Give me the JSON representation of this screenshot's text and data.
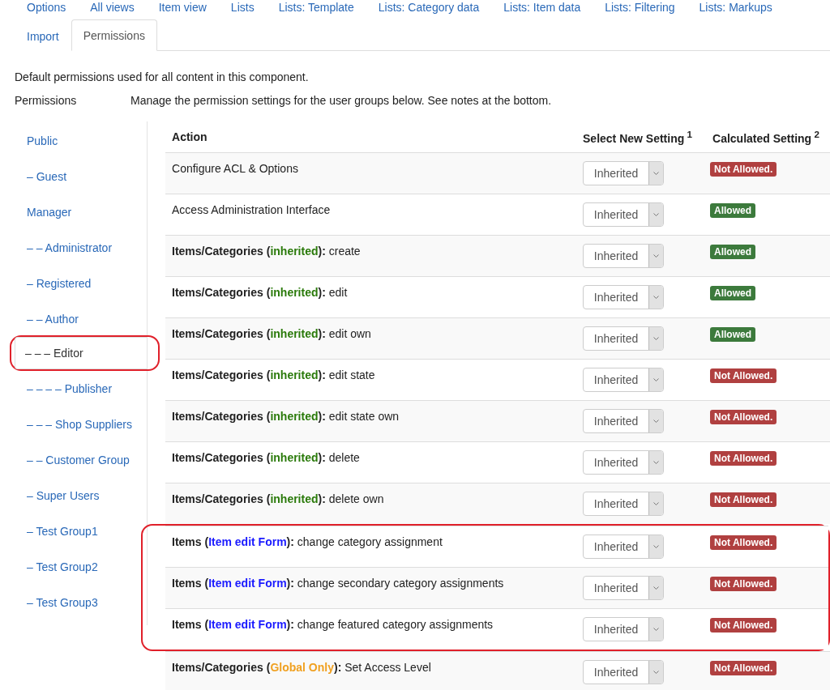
{
  "tabs_row_1": [
    {
      "label": "Options",
      "selected": false
    },
    {
      "label": "All views",
      "selected": false
    },
    {
      "label": "Item view",
      "selected": false
    },
    {
      "label": "Lists",
      "selected": false
    },
    {
      "label": "Lists: Template",
      "selected": false
    },
    {
      "label": "Lists: Category data",
      "selected": false
    },
    {
      "label": "Lists: Item data",
      "selected": false
    },
    {
      "label": "Lists: Filtering",
      "selected": false
    },
    {
      "label": "Lists: Markups",
      "selected": false
    }
  ],
  "tabs_row_2": [
    {
      "label": "Import",
      "selected": false
    },
    {
      "label": "Permissions",
      "selected": true
    }
  ],
  "intro": "Default permissions used for all content in this component.",
  "field_label": "Permissions",
  "field_description": "Manage the permission settings for the user groups below. See notes at the bottom.",
  "groups": [
    {
      "label": "Public",
      "selected": false,
      "circled": false
    },
    {
      "label": "– Guest",
      "selected": false,
      "circled": false
    },
    {
      "label": "Manager",
      "selected": false,
      "circled": false
    },
    {
      "label": "– – Administrator",
      "selected": false,
      "circled": false
    },
    {
      "label": "– Registered",
      "selected": false,
      "circled": false
    },
    {
      "label": "– – Author",
      "selected": false,
      "circled": false
    },
    {
      "label": "– – – Editor",
      "selected": true,
      "circled": true
    },
    {
      "label": "– – – – Publisher",
      "selected": false,
      "circled": false
    },
    {
      "label": "– – – Shop Suppliers",
      "selected": false,
      "circled": false
    },
    {
      "label": "– – Customer Group",
      "selected": false,
      "circled": false
    },
    {
      "label": "– Super Users",
      "selected": false,
      "circled": false
    },
    {
      "label": "– Test Group1",
      "selected": false,
      "circled": false
    },
    {
      "label": "– Test Group2",
      "selected": false,
      "circled": false
    },
    {
      "label": "– Test Group3",
      "selected": false,
      "circled": false
    }
  ],
  "table": {
    "columns": [
      {
        "label": "Action"
      },
      {
        "label": "Select New Setting",
        "note": "1"
      },
      {
        "label": "Calculated Setting",
        "note": "2"
      }
    ],
    "rows": [
      {
        "kind": "plain",
        "text": "Configure ACL & Options",
        "setting": "Inherited",
        "result": "Not Allowed.",
        "allowed": false,
        "circled": false
      },
      {
        "kind": "plain",
        "text": "Access Administration Interface",
        "setting": "Inherited",
        "result": "Allowed",
        "allowed": true,
        "circled": false
      },
      {
        "kind": "scoped",
        "prefix": "Items/Categories (",
        "scope": "inherited",
        "color": "#2a7a0a",
        "text": "**):** create",
        "setting": "Inherited",
        "result": "Allowed",
        "allowed": true,
        "circled": false
      },
      {
        "kind": "scoped",
        "prefix": "Items/Categories (",
        "scope": "inherited",
        "color": "#2a7a0a",
        "text": "**):** edit",
        "setting": "Inherited",
        "result": "Allowed",
        "allowed": true,
        "circled": false
      },
      {
        "kind": "scoped",
        "prefix": "Items/Categories (",
        "scope": "inherited",
        "color": "#2a7a0a",
        "text": "**):** edit own",
        "setting": "Inherited",
        "result": "Allowed",
        "allowed": true,
        "circled": false
      },
      {
        "kind": "scoped",
        "prefix": "Items/Categories (",
        "scope": "inherited",
        "color": "#2a7a0a",
        "text": "**):** edit state",
        "setting": "Inherited",
        "result": "Not Allowed.",
        "allowed": false,
        "circled": false
      },
      {
        "kind": "scoped",
        "prefix": "Items/Categories (",
        "scope": "inherited",
        "color": "#2a7a0a",
        "text": "**):** edit state own",
        "setting": "Inherited",
        "result": "Not Allowed.",
        "allowed": false,
        "circled": false
      },
      {
        "kind": "scoped",
        "prefix": "Items/Categories (",
        "scope": "inherited",
        "color": "#2a7a0a",
        "text": "**):** delete",
        "setting": "Inherited",
        "result": "Not Allowed.",
        "allowed": false,
        "circled": false
      },
      {
        "kind": "scoped",
        "prefix": "Items/Categories (",
        "scope": "inherited",
        "color": "#2a7a0a",
        "text": "**):** delete own",
        "setting": "Inherited",
        "result": "Not Allowed.",
        "allowed": false,
        "circled": false
      },
      {
        "kind": "scoped",
        "prefix": "Items (",
        "scope": "Item edit Form",
        "color": "#1a1aff",
        "text": "**):** change category assignment",
        "setting": "Inherited",
        "result": "Not Allowed.",
        "allowed": false,
        "circled": true
      },
      {
        "kind": "scoped",
        "prefix": "Items (",
        "scope": "Item edit Form",
        "color": "#1a1aff",
        "text": "**):** change secondary category assignments",
        "setting": "Inherited",
        "result": "Not Allowed.",
        "allowed": false,
        "circled": true
      },
      {
        "kind": "scoped",
        "prefix": "Items (",
        "scope": "Item edit Form",
        "color": "#1a1aff",
        "text": "**):** change featured category assignments",
        "setting": "Inherited",
        "result": "Not Allowed.",
        "allowed": false,
        "circled": true
      },
      {
        "kind": "scoped",
        "prefix": "Items/Categories (",
        "scope": "Global Only",
        "color": "#f0a020",
        "text": "**):** Set Access Level",
        "setting": "Inherited",
        "result": "Not Allowed.",
        "allowed": false,
        "circled": false
      }
    ]
  }
}
